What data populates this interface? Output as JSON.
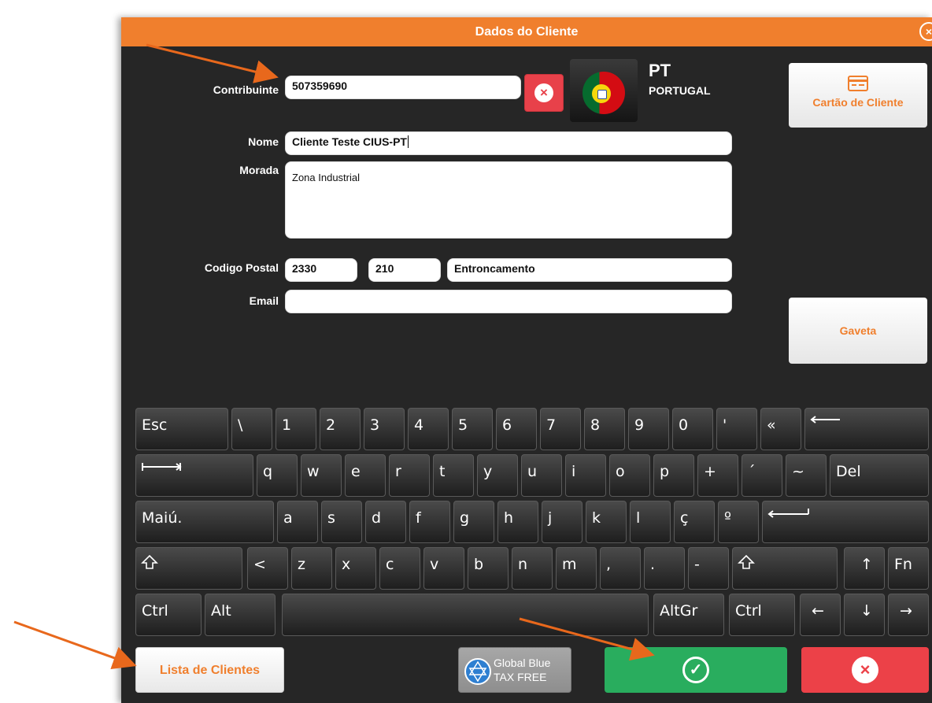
{
  "dialog": {
    "title": "Dados do Cliente",
    "close_glyph": "×"
  },
  "form": {
    "contribuinte_label": "Contribuinte",
    "contribuinte_value": "507359690",
    "nome_label": "Nome",
    "nome_value": "Cliente Teste CIUS-PT",
    "morada_label": "Morada",
    "morada_value": "Zona Industrial",
    "codigo_postal_label": "Codigo Postal",
    "codigo_postal_1": "2330",
    "codigo_postal_2": "210",
    "localidade": "Entroncamento",
    "email_label": "Email",
    "email_value": ""
  },
  "country": {
    "code": "PT",
    "name": "PORTUGAL",
    "flag_icon": "portugal-flag-icon"
  },
  "side_buttons": {
    "cartao_label": "Cartão de Cliente",
    "gaveta_label": "Gaveta"
  },
  "keyboard": {
    "row1": [
      "Esc",
      "\\",
      "1",
      "2",
      "3",
      "4",
      "5",
      "6",
      "7",
      "8",
      "9",
      "0",
      "'",
      "«",
      ""
    ],
    "row2": [
      "",
      "q",
      "w",
      "e",
      "r",
      "t",
      "y",
      "u",
      "i",
      "o",
      "p",
      "+",
      "´",
      "~",
      "Del"
    ],
    "row3": [
      "Maiú.",
      "a",
      "s",
      "d",
      "f",
      "g",
      "h",
      "j",
      "k",
      "l",
      "ç",
      "º",
      ""
    ],
    "row4": [
      "",
      "<",
      "z",
      "x",
      "c",
      "v",
      "b",
      "n",
      "m",
      ",",
      ".",
      "-",
      "",
      "↑",
      "Fn"
    ],
    "row5": [
      "Ctrl",
      "Alt",
      "",
      "AltGr",
      "Ctrl",
      "←",
      "↓",
      "→"
    ]
  },
  "bottom": {
    "lista_label": "Lista de Clientes",
    "globalblue_line1": "Global Blue",
    "globalblue_line2": "TAX FREE",
    "ok_icon": "check-circle-icon",
    "cancel_glyph": "×"
  },
  "colors": {
    "accent": "#f07f2d",
    "dialog_bg": "#262626",
    "ok": "#29ad5e",
    "cancel": "#ec4148"
  }
}
